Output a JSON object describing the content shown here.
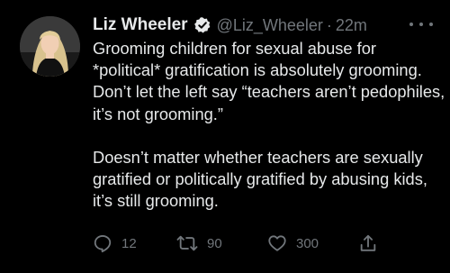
{
  "tweet": {
    "author_name": "Liz Wheeler",
    "handle": "@Liz_Wheeler",
    "separator": "·",
    "time": "22m",
    "paragraphs": [
      "Grooming children for sexual abuse for *political* gratification is absolutely grooming. Don’t let the left say “teachers aren’t pedophiles, it’s not grooming.”",
      "Doesn’t matter whether teachers are sexually gratified or politically gratified by abusing kids, it’s still grooming."
    ],
    "actions": {
      "replies": "12",
      "retweets": "90",
      "likes": "300"
    }
  },
  "icons": {
    "verified": "verified-badge-icon",
    "more": "more-options-icon",
    "reply": "reply-icon",
    "retweet": "retweet-icon",
    "like": "heart-icon",
    "share": "share-icon"
  },
  "colors": {
    "background": "#000000",
    "primary_text": "#e7e9ea",
    "secondary_text": "#71767b"
  }
}
